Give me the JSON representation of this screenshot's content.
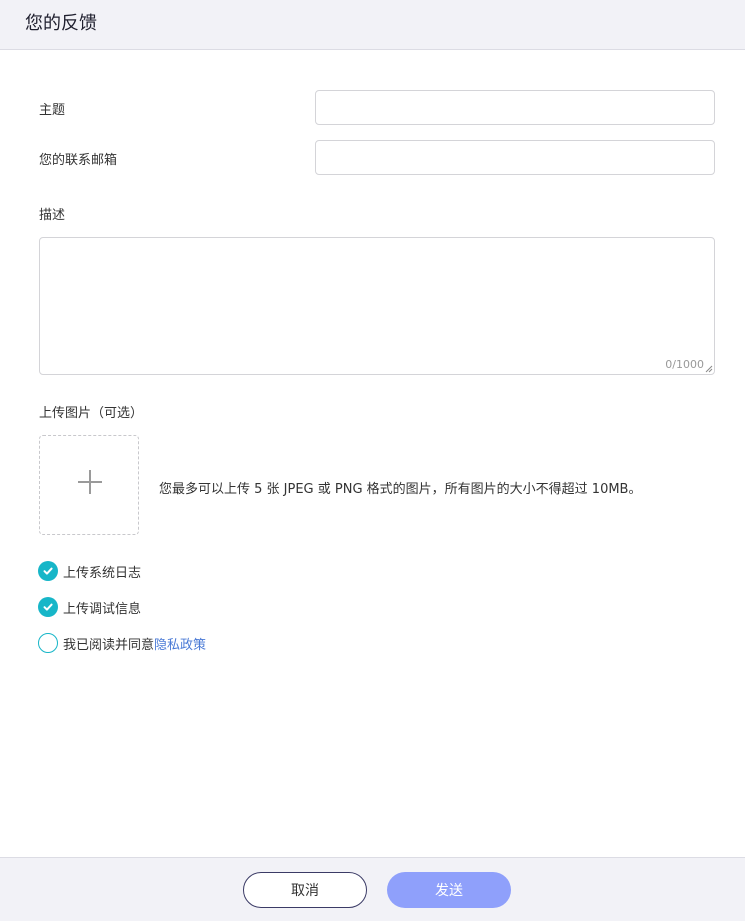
{
  "header": {
    "title": "您的反馈"
  },
  "form": {
    "subject_label": "主题",
    "subject_value": "",
    "email_label": "您的联系邮箱",
    "email_value": "",
    "description_label": "描述",
    "description_value": "",
    "description_counter": "0/1000",
    "upload_label": "上传图片（可选）",
    "upload_hint": "您最多可以上传 5 张 JPEG 或 PNG 格式的图片，所有图片的大小不得超过 10MB。"
  },
  "options": {
    "upload_logs": {
      "label": "上传系统日志",
      "checked": true
    },
    "upload_debug": {
      "label": "上传调试信息",
      "checked": true
    },
    "privacy": {
      "label_prefix": "我已阅读并同意",
      "link_text": "隐私政策",
      "checked": false
    }
  },
  "footer": {
    "cancel_label": "取消",
    "send_label": "发送"
  },
  "colors": {
    "accent": "#17b6c8",
    "link": "#4a7ad6",
    "send_button": "#8fa0fb"
  }
}
